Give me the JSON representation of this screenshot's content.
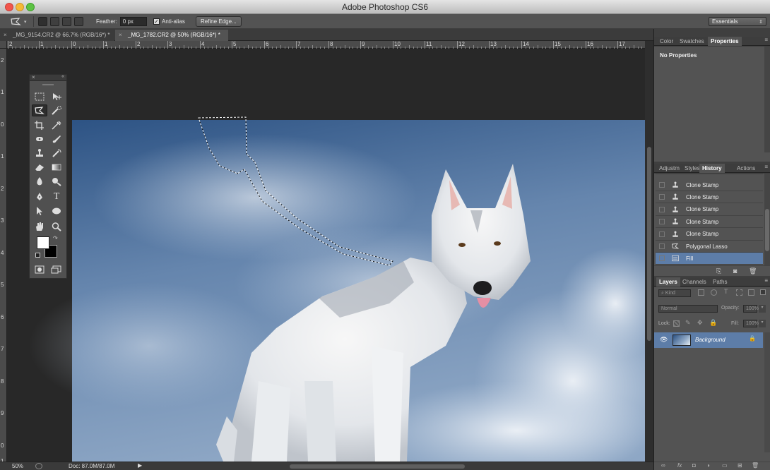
{
  "window": {
    "title": "Adobe Photoshop CS6",
    "workspace": "Essentials"
  },
  "options_bar": {
    "feather_label": "Feather:",
    "feather_value": "0 px",
    "antialias_label": "Anti-alias",
    "refine_edge_label": "Refine Edge..."
  },
  "document_tabs": [
    {
      "label": "_MG_9154.CR2 @ 66.7% (RGB/16*) *",
      "active": false
    },
    {
      "label": "_MG_1782.CR2 @ 50% (RGB/16*) *",
      "active": true
    }
  ],
  "ruler_h": [
    "2",
    "1",
    "0",
    "1",
    "2",
    "3",
    "4",
    "5",
    "6",
    "7",
    "8",
    "9",
    "10",
    "11",
    "12",
    "13",
    "14",
    "15",
    "16",
    "17"
  ],
  "ruler_v": [
    "2",
    "1",
    "0",
    "1",
    "2",
    "3",
    "4",
    "5",
    "6",
    "7",
    "8",
    "9",
    "0",
    "1"
  ],
  "status": {
    "zoom": "50%",
    "doc_info": "Doc: 87.0M/87.0M"
  },
  "panel_group1": {
    "tabs": [
      "Color",
      "Swatches",
      "Properties"
    ],
    "active": "Properties",
    "content": "No Properties"
  },
  "panel_group2": {
    "tabs": [
      "Adjustm",
      "Styles",
      "History",
      "Actions"
    ],
    "active": "History",
    "items": [
      {
        "label": "Clone Stamp",
        "icon": "clone-stamp-icon"
      },
      {
        "label": "Clone Stamp",
        "icon": "clone-stamp-icon"
      },
      {
        "label": "Clone Stamp",
        "icon": "clone-stamp-icon"
      },
      {
        "label": "Clone Stamp",
        "icon": "clone-stamp-icon"
      },
      {
        "label": "Clone Stamp",
        "icon": "clone-stamp-icon"
      },
      {
        "label": "Polygonal Lasso",
        "icon": "polygonal-lasso-icon"
      },
      {
        "label": "Fill",
        "icon": "fill-icon"
      }
    ],
    "selected": "Fill"
  },
  "panel_group3": {
    "tabs": [
      "Layers",
      "Channels",
      "Paths"
    ],
    "active": "Layers",
    "kind": "Kind",
    "blend_mode": "Normal",
    "opacity_label": "Opacity:",
    "opacity": "100%",
    "lock_label": "Lock:",
    "fill_label": "Fill:",
    "fill": "100%",
    "layers": [
      {
        "name": "Background",
        "visible": true,
        "locked": true
      }
    ]
  },
  "colors": {
    "accent": "#5c7ca3",
    "selected_row": "#5d7da8"
  }
}
